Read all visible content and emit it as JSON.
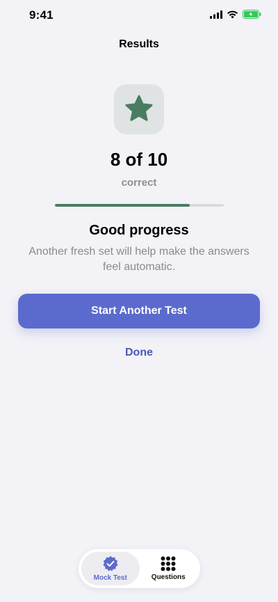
{
  "status": {
    "time": "9:41"
  },
  "nav": {
    "title": "Results"
  },
  "result": {
    "icon": "star-icon",
    "score": "8 of 10",
    "score_sub": "correct",
    "progress": 0.8,
    "headline": "Good progress",
    "message": "Another fresh set will help make the answers feel automatic."
  },
  "actions": {
    "primary": "Start Another Test",
    "secondary": "Done"
  },
  "tabs": [
    {
      "label": "Mock Test",
      "icon": "check-badge-icon",
      "active": true
    },
    {
      "label": "Questions",
      "icon": "grid-icon",
      "active": false
    }
  ],
  "colors": {
    "accent": "#5b6bcd",
    "success": "#4a7c60",
    "background": "#f2f2f7"
  }
}
